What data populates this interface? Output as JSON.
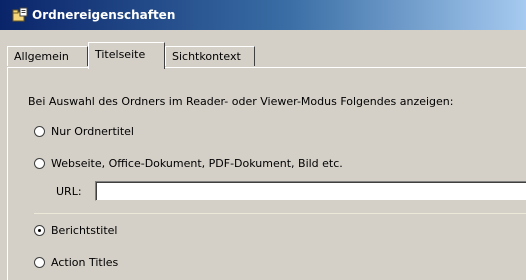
{
  "window": {
    "title": "Ordnereigenschaften",
    "icon": "folder-properties-icon"
  },
  "tabs": [
    {
      "label": "Allgemein",
      "active": false
    },
    {
      "label": "Titelseite",
      "active": true
    },
    {
      "label": "Sichtkontext",
      "active": false
    }
  ],
  "panel": {
    "intro": "Bei Auswahl des Ordners im Reader- oder Viewer-Modus Folgendes anzeigen:",
    "options": [
      {
        "label": "Nur Ordnertitel",
        "checked": false
      },
      {
        "label": "Webseite, Office-Dokument, PDF-Dokument, Bild etc.",
        "checked": false
      },
      {
        "label": "Berichtstitel",
        "checked": true
      },
      {
        "label": "Action Titles",
        "checked": false
      }
    ],
    "url": {
      "label": "URL:",
      "value": ""
    }
  }
}
